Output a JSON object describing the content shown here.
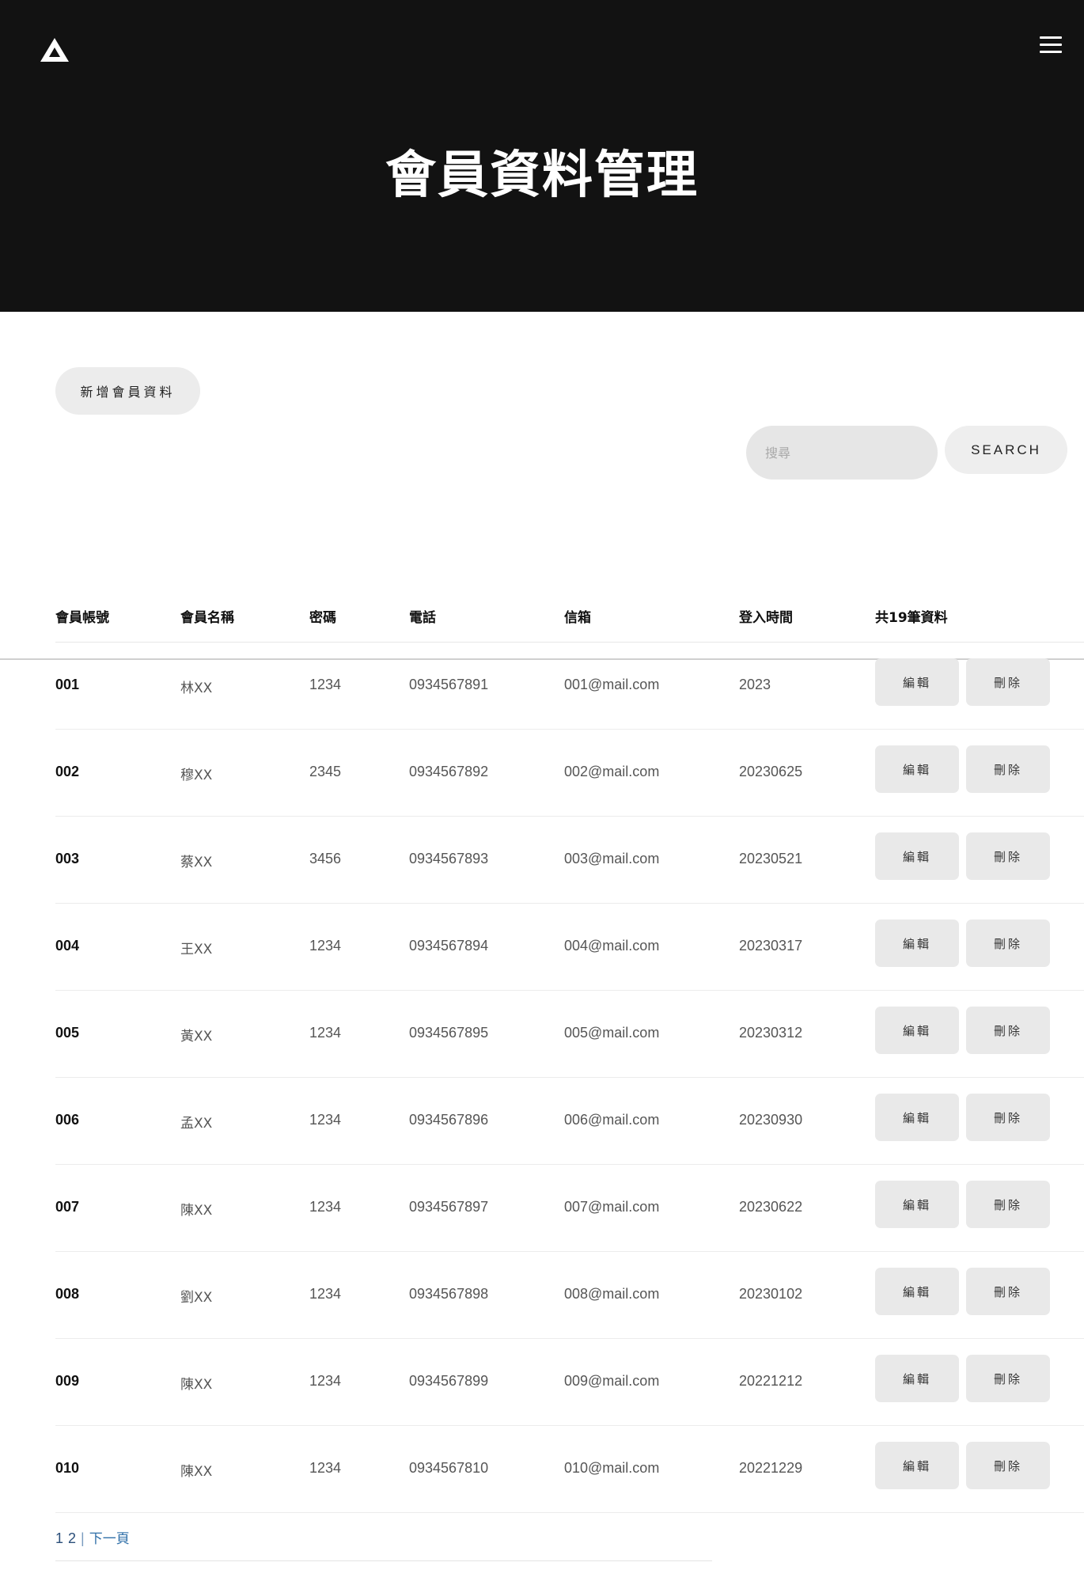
{
  "header": {
    "logo_icon": "mountain-logo-icon",
    "menu_icon": "hamburger-menu-icon",
    "title": "會員資料管理"
  },
  "toolbar": {
    "add_label": "新增會員資料",
    "search_placeholder": "搜尋",
    "search_label": "SEARCH"
  },
  "table": {
    "columns": [
      "會員帳號",
      "會員名稱",
      "密碼",
      "電話",
      "信箱",
      "登入時間",
      "共19筆資料"
    ],
    "edit_label": "編輯",
    "delete_label": "刪除",
    "rows": [
      {
        "id": "001",
        "name": "林XX",
        "password": "1234",
        "phone": "0934567891",
        "email": "001@mail.com",
        "login": "2023"
      },
      {
        "id": "002",
        "name": "穆XX",
        "password": "2345",
        "phone": "0934567892",
        "email": "002@mail.com",
        "login": "20230625"
      },
      {
        "id": "003",
        "name": "蔡XX",
        "password": "3456",
        "phone": "0934567893",
        "email": "003@mail.com",
        "login": "20230521"
      },
      {
        "id": "004",
        "name": "王XX",
        "password": "1234",
        "phone": "0934567894",
        "email": "004@mail.com",
        "login": "20230317"
      },
      {
        "id": "005",
        "name": "黃XX",
        "password": "1234",
        "phone": "0934567895",
        "email": "005@mail.com",
        "login": "20230312"
      },
      {
        "id": "006",
        "name": "孟XX",
        "password": "1234",
        "phone": "0934567896",
        "email": "006@mail.com",
        "login": "20230930"
      },
      {
        "id": "007",
        "name": "陳XX",
        "password": "1234",
        "phone": "0934567897",
        "email": "007@mail.com",
        "login": "20230622"
      },
      {
        "id": "008",
        "name": "劉XX",
        "password": "1234",
        "phone": "0934567898",
        "email": "008@mail.com",
        "login": "20230102"
      },
      {
        "id": "009",
        "name": "陳XX",
        "password": "1234",
        "phone": "0934567899",
        "email": "009@mail.com",
        "login": "20221212"
      },
      {
        "id": "010",
        "name": "陳XX",
        "password": "1234",
        "phone": "0934567810",
        "email": "010@mail.com",
        "login": "20221229"
      }
    ]
  },
  "pagination": {
    "pages": [
      "1",
      "2"
    ],
    "separator": "|",
    "next_label": "下一頁"
  }
}
